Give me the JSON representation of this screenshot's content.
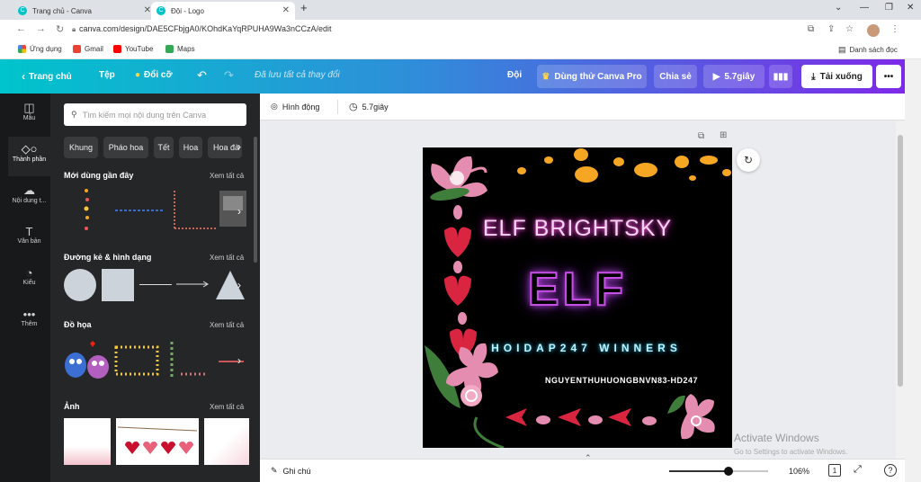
{
  "browser": {
    "tabs": [
      {
        "title": "Trang chủ - Canva"
      },
      {
        "title": "Đội - Logo"
      }
    ],
    "url": "canva.com/design/DAE5CFbjgA0/KOhdKaYqRPUHA9Wa3nCCzA/edit",
    "bookmarks": [
      "Ứng dụng",
      "Gmail",
      "YouTube",
      "Maps"
    ],
    "reading_list": "Danh sách đọc"
  },
  "header": {
    "home": "Trang chủ",
    "file": "Tệp",
    "resize": "Đổi cỡ",
    "saved_status": "Đã lưu tất cả thay đổi",
    "team": "Đội",
    "try_pro": "Dùng thử Canva Pro",
    "share": "Chia sẻ",
    "play_duration": "5.7giây",
    "download": "Tải xuống",
    "more": "•••",
    "accent_color": "#7d2ae8"
  },
  "rail": [
    {
      "label": "Mẫu",
      "icon": "template-icon"
    },
    {
      "label": "Thành phần",
      "icon": "elements-icon"
    },
    {
      "label": "Nội dung t...",
      "icon": "upload-icon"
    },
    {
      "label": "Văn bản",
      "icon": "text-icon"
    },
    {
      "label": "Kiểu",
      "icon": "palette-icon"
    },
    {
      "label": "Thêm",
      "icon": "more-icon"
    }
  ],
  "panel": {
    "search_placeholder": "Tìm kiếm mọi nội dung trên Canva",
    "chips": [
      "Khung",
      "Pháo hoa",
      "Tết",
      "Hoa",
      "Hoa đà"
    ],
    "sections": [
      {
        "title": "Mới dùng gần đây",
        "see_all": "Xem tất cả"
      },
      {
        "title": "Đường kẻ & hình dạng",
        "see_all": "Xem tất cả"
      },
      {
        "title": "Đồ họa",
        "see_all": "Xem tất cả"
      },
      {
        "title": "Ảnh",
        "see_all": "Xem tất cả"
      }
    ]
  },
  "canvas_toolbar": {
    "animate": "Hình động",
    "duration": "5.7giây"
  },
  "design": {
    "title": "ELF BRIGHTSKY",
    "logo": "ELF",
    "tagline": "HOIDAP247 WINNERS",
    "credit": "NGUYENTHUHUONGBNVN83-HD247"
  },
  "bottom": {
    "notes": "Ghi chú",
    "zoom": "106%",
    "zoom_level": 0.6,
    "page_count": "1"
  },
  "watermark": {
    "line1": "Activate Windows",
    "line2": "Go to Settings to activate Windows."
  }
}
